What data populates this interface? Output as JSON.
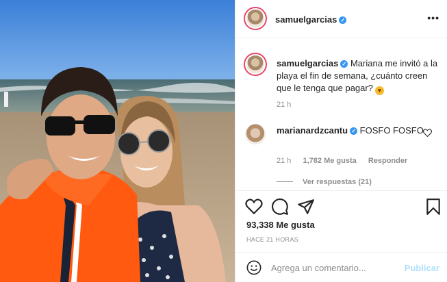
{
  "post": {
    "username": "samuelgarcias",
    "caption": "Mariana me invitó a la playa el fin de semana, ¿cuánto creen que le tenga que pagar?",
    "caption_time": "21 h",
    "likes": "93,338 Me gusta",
    "posted": "HACE 21 HORAS"
  },
  "comment": {
    "username": "marianardzcantu",
    "text": "FOSFO FOSFO",
    "time": "21 h",
    "likes": "1,782 Me gusta",
    "reply_label": "Responder",
    "view_replies": "Ver respuestas (21)"
  },
  "composer": {
    "placeholder": "Agrega un comentario...",
    "publish_label": "Publicar"
  },
  "icons": {
    "more": "more-options-icon",
    "verified": "verified-badge-icon",
    "like": "heart-icon",
    "comment": "comment-icon",
    "share": "paper-plane-icon",
    "save": "bookmark-icon",
    "emoji": "smiley-icon"
  },
  "colors": {
    "verified": "#3897f0",
    "story_ring": "#e8456b",
    "muted_text": "#8e8e8e",
    "publish_disabled": "#b2dffc"
  }
}
